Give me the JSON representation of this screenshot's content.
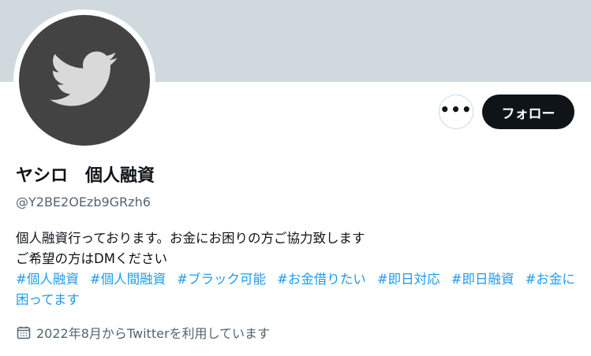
{
  "profile": {
    "display_name": "ヤシロ　個人融資",
    "handle": "@Y2BE2OEzb9GRzh6",
    "bio_line1": "個人融資行っております。お金にお困りの方ご協力致します",
    "bio_line2": "ご希望の方はDMください",
    "hashtags": [
      "#個人融資",
      "#個人間融資",
      "#ブラック可能",
      "#お金借りたい",
      "#即日対応",
      "#即日融資",
      "#お金に困ってます"
    ],
    "joined": "2022年8月からTwitterを利用しています"
  },
  "actions": {
    "more_label": "•••",
    "follow_label": "フォロー"
  },
  "icons": {
    "avatar": "twitter-bird-icon",
    "more": "more-icon",
    "calendar": "calendar-icon"
  },
  "colors": {
    "banner": "#cfd9de",
    "avatar_bg": "#434343",
    "follow_bg": "#0f1419",
    "hashtag": "#1d9bf0",
    "muted_text": "#536471"
  }
}
